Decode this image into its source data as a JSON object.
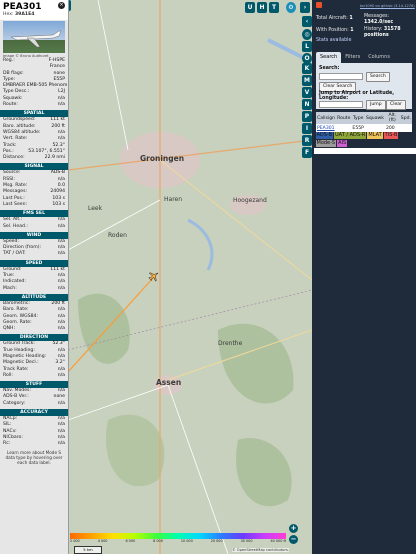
{
  "info": {
    "callsign": "PEA301",
    "hex_label": "Hex:",
    "hex_value": "39A1E4",
    "photo_credit": "Image © Bruno Audhuret",
    "reg_rows": [
      {
        "k": "Reg.:",
        "v": "F-HSPE"
      },
      {
        "k": "",
        "v": "France"
      },
      {
        "k": "DB flags:",
        "v": "none"
      },
      {
        "k": "Type:",
        "v": "E55P"
      },
      {
        "k": "",
        "v": "EMBRAER EMB-505 Phenom 300"
      },
      {
        "k": "Type Desc.:",
        "v": "L2J"
      },
      {
        "k": "Squawk:",
        "v": "n/a"
      },
      {
        "k": "Route:",
        "v": "n/a"
      }
    ],
    "sections": [
      {
        "title": "SPATIAL",
        "rows": [
          {
            "k": "Groundspeed:",
            "v": "111 kt"
          },
          {
            "k": "Baro. altitude:",
            "v": "200 ft"
          },
          {
            "k": "WGS84 altitude:",
            "v": "n/a"
          },
          {
            "k": "Vert. Rate:",
            "v": "n/a"
          },
          {
            "k": "Track:",
            "v": "52.3°"
          },
          {
            "k": "Pos.:",
            "v": "53.107°, 6.551°"
          },
          {
            "k": "Distance:",
            "v": "22.9 nmi"
          }
        ]
      },
      {
        "title": "SIGNAL",
        "rows": [
          {
            "k": "Source:",
            "v": "ADS-B"
          },
          {
            "k": "RSSI:",
            "v": "n/a"
          },
          {
            "k": "Msg. Rate:",
            "v": "0.0"
          },
          {
            "k": "Messages:",
            "v": "24094"
          },
          {
            "k": "Last Pos.:",
            "v": "103 s"
          },
          {
            "k": "Last Seen:",
            "v": "103 s"
          }
        ]
      },
      {
        "title": "FMS SEL",
        "rows": [
          {
            "k": "Sel. Alt.:",
            "v": "n/a"
          },
          {
            "k": "Sel. Head.:",
            "v": "n/a"
          }
        ]
      },
      {
        "title": "WIND",
        "rows": [
          {
            "k": "Speed:",
            "v": "n/a"
          },
          {
            "k": "Direction (from):",
            "v": "n/a"
          },
          {
            "k": "TAT / OAT:",
            "v": "n/a"
          }
        ]
      },
      {
        "title": "SPEED",
        "rows": [
          {
            "k": "Ground:",
            "v": "111 kt"
          },
          {
            "k": "True:",
            "v": "n/a"
          },
          {
            "k": "Indicated:",
            "v": "n/a"
          },
          {
            "k": "Mach:",
            "v": "n/a"
          }
        ]
      },
      {
        "title": "ALTITUDE",
        "rows": [
          {
            "k": "Barometric:",
            "v": "200 ft"
          },
          {
            "k": "Baro. Rate:",
            "v": "n/a"
          },
          {
            "k": "Geom. WGS84:",
            "v": "n/a"
          },
          {
            "k": "Geom. Rate:",
            "v": "n/a"
          },
          {
            "k": "QNH:",
            "v": "n/a"
          }
        ]
      },
      {
        "title": "DIRECTION",
        "rows": [
          {
            "k": "Ground Track:",
            "v": "52.3°"
          },
          {
            "k": "True Heading:",
            "v": "n/a"
          },
          {
            "k": "Magnetic Heading:",
            "v": "n/a"
          },
          {
            "k": "Magnetic Decl.:",
            "v": "3.2°"
          },
          {
            "k": "Track Rate:",
            "v": "n/a"
          },
          {
            "k": "Roll:",
            "v": "n/a"
          }
        ]
      },
      {
        "title": "STUFF",
        "rows": [
          {
            "k": "Nav. Modes:",
            "v": "n/a"
          },
          {
            "k": "ADS-B Ver.:",
            "v": "none"
          },
          {
            "k": "Category:",
            "v": "n/a"
          }
        ]
      },
      {
        "title": "ACCURACY",
        "rows": [
          {
            "k": "NACp:",
            "v": "n/a"
          },
          {
            "k": "SIL:",
            "v": "n/a"
          },
          {
            "k": "NACv:",
            "v": "n/a"
          },
          {
            "k": "NICbaro:",
            "v": "n/a"
          },
          {
            "k": "Rc:",
            "v": "n/a"
          }
        ]
      }
    ],
    "footer": "Learn more about Mode S data type by hovering over each data label."
  },
  "top_buttons": [
    "U",
    "H",
    "T"
  ],
  "right_buttons": [
    "L",
    "O",
    "K",
    "M",
    "V",
    "N",
    "P",
    "I",
    "R",
    "F"
  ],
  "sidebar": {
    "link": "tar1090 on github (3.14.1278)",
    "total_aircraft_label": "Total Aircraft:",
    "total_aircraft": "1",
    "with_position_label": "With Position:",
    "with_position": "1",
    "stats_label": "Stats available",
    "messages_label": "Messages:",
    "messages": "1342.0/sec",
    "history_label": "History:",
    "history": "31578 positions",
    "tabs": [
      "Search",
      "Filters",
      "Columns"
    ],
    "search_label": "Search:",
    "search_button": "Search",
    "clear_search": "Clear Search",
    "jump_label": "Jump to Airport or Latitude, Longitude:",
    "jump_button": "Jump",
    "clear_button": "Clear",
    "table_headers": [
      "Callsign",
      "Route",
      "Type",
      "Squawk",
      "Alt. (ft)",
      "Spd."
    ],
    "table_rows": [
      [
        "PEA301",
        "",
        "E55P",
        "",
        "200",
        ""
      ]
    ],
    "legend": [
      {
        "label": "ADS-B",
        "color": "#2f5ea6"
      },
      {
        "label": "UAT / ADS-R",
        "color": "#8fa63a"
      },
      {
        "label": "MLAT",
        "color": "#f0c35a"
      },
      {
        "label": "TIS-B",
        "color": "#e85a5a"
      },
      {
        "label": "Mode-S",
        "color": "#9c9c9c"
      },
      {
        "label": "AIS",
        "color": "#d060d0"
      }
    ]
  },
  "map": {
    "labels": [
      {
        "t": "Groningen",
        "big": true
      },
      {
        "t": "Assen",
        "big": true
      },
      {
        "t": "Drenthe",
        "big": false
      },
      {
        "t": "Hoogezand",
        "big": false
      },
      {
        "t": "Leek",
        "big": false
      },
      {
        "t": "Roden",
        "big": false
      },
      {
        "t": "Haren",
        "big": false
      }
    ],
    "alt_ticks": [
      "2 000",
      "4 000",
      "6 000",
      "8 000",
      "10 000",
      "20 000",
      "30 000",
      "40 000 ft"
    ],
    "scale": "5 km",
    "attribution": "© OpenStreetMap contributors."
  }
}
